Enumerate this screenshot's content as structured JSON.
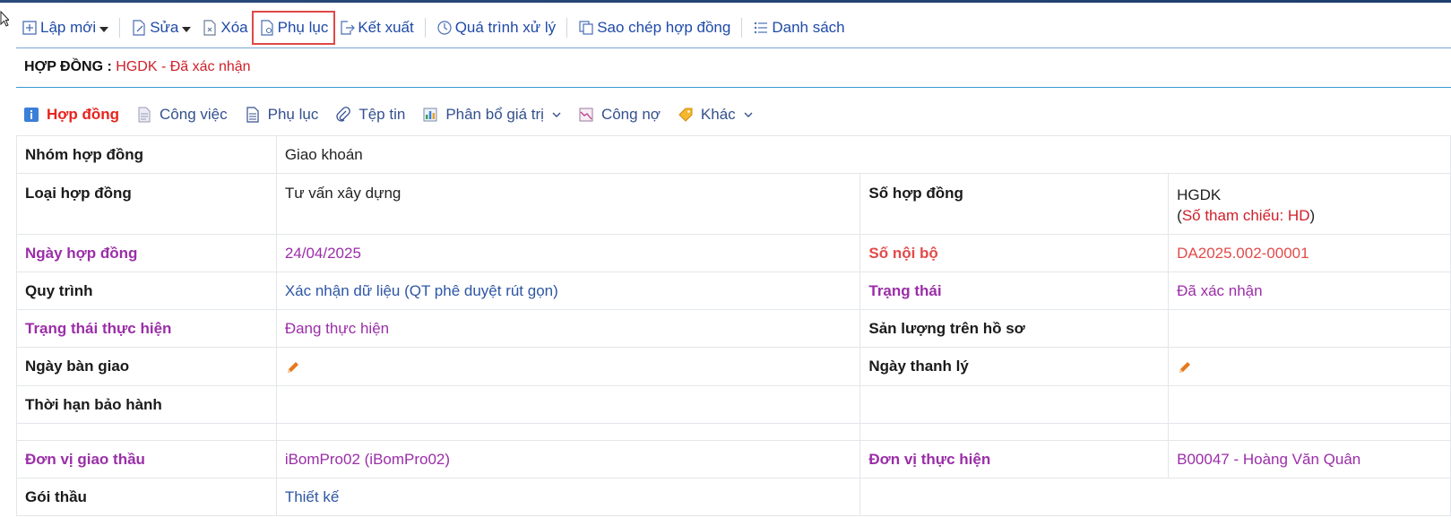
{
  "toolbar": {
    "new": "Lập mới",
    "edit": "Sửa",
    "delete": "Xóa",
    "appendix": "Phụ lục",
    "export": "Kết xuất",
    "process": "Quá trình xử lý",
    "copy": "Sao chép hợp đồng",
    "list": "Danh sách"
  },
  "heading": {
    "label": "HỢP ĐỒNG :",
    "value": "HGDK - Đã xác nhận"
  },
  "tabs": [
    {
      "label": "Hợp đồng"
    },
    {
      "label": "Công việc"
    },
    {
      "label": "Phụ lục"
    },
    {
      "label": "Tệp tin"
    },
    {
      "label": "Phân bổ giá trị"
    },
    {
      "label": "Công nợ"
    },
    {
      "label": "Khác"
    }
  ],
  "fields": {
    "group_label": "Nhóm hợp đồng",
    "group_value": "Giao khoán",
    "type_label": "Loại hợp đồng",
    "type_value": "Tư vấn xây dựng",
    "number_label": "Số hợp đồng",
    "number_value": "HGDK",
    "reference_text": "Số tham chiếu: HD",
    "date_label": "Ngày hợp đồng",
    "date_value": "24/04/2025",
    "internal_label": "Số nội bộ",
    "internal_value": "DA2025.002-00001",
    "process_label": "Quy trình",
    "process_value": "Xác nhận dữ liệu (QT phê duyệt rút gọn)",
    "status_label": "Trạng thái",
    "status_value": "Đã xác nhận",
    "exec_status_label": "Trạng thái thực hiện",
    "exec_status_value": "Đang thực hiện",
    "output_label": "Sản lượng trên hồ sơ",
    "handover_label": "Ngày bàn giao",
    "liquidation_label": "Ngày thanh lý",
    "warranty_label": "Thời hạn bảo hành",
    "contractor_label": "Đơn vị giao thầu",
    "contractor_value": "iBomPro02 (iBomPro02)",
    "executor_label": "Đơn vị thực hiện",
    "executor_value": "B00047 - Hoàng Văn Quân",
    "package_label": "Gói thầu",
    "package_value": "Thiết kế"
  },
  "colors": {
    "link_blue": "#1f4aa8",
    "red": "#d0202a",
    "pink": "#9b2ea8",
    "orange": "#e8781e"
  },
  "icons": [
    "plus-square-icon",
    "edit-doc-icon",
    "delete-doc-icon",
    "appendix-doc-icon",
    "export-icon",
    "history-clock-icon",
    "copy-icon",
    "list-icon",
    "info-icon",
    "document-icon",
    "page-icon",
    "paperclip-icon",
    "bar-chart-icon",
    "line-chart-icon",
    "tag-icon",
    "pencil-icon"
  ]
}
